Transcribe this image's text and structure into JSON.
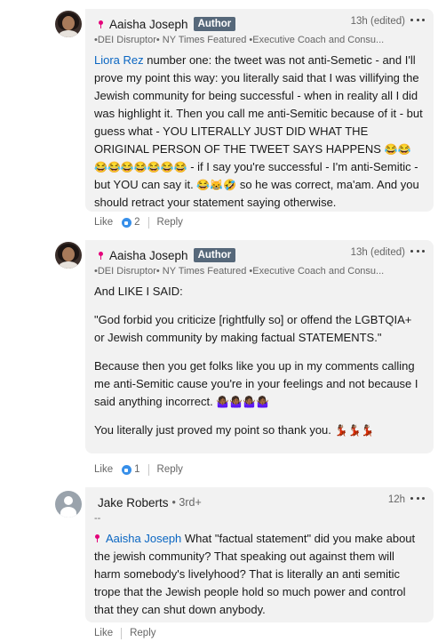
{
  "comments": [
    {
      "author": "Aaisha Joseph",
      "badge": "Author",
      "time": "13h (edited)",
      "headline": "•DEI Disruptor• NY Times Featured •Executive Coach and Consu...",
      "mention": "Liora Rez",
      "text_1": " number one: the tweet was not anti-Semetic - and I'll prove my point this way: you literally said that I was villifying the Jewish community for being successful - when in reality all I did was highlight it. Then you call me anti-Semitic because of it - but guess what - YOU LITERALLY JUST DID WHAT THE ORIGINAL PERSON OF THE TWEET SAYS HAPPENS ",
      "emoji_1": "😂😂😂😂😂😂😂😂😂",
      "text_2": " - if I say you're successful - I'm anti-Semitic - but YOU can say it. ",
      "emoji_2": "😂😹🤣",
      "text_3": " so he was correct, ma'am. And you should retract your statement saying otherwise.",
      "like_label": "Like",
      "like_count": "2",
      "reply_label": "Reply"
    },
    {
      "author": "Aaisha Joseph",
      "badge": "Author",
      "time": "13h (edited)",
      "headline": "•DEI Disruptor• NY Times Featured •Executive Coach and Consu...",
      "para_1": "And LIKE I SAID:",
      "para_2": "\"God forbid you criticize [rightfully so] or offend the LGBTQIA+ or Jewish community by making factual STATEMENTS.\"",
      "para_3": "Because then you get folks like you up in my comments calling me anti-Semitic cause you're in your feelings and not because I said anything incorrect. ",
      "para_3_emoji": "🤷🏾‍♀️🤷🏾‍♀️🤷🏾‍♀️🤷🏾‍♀️",
      "para_4": "You literally just proved my point so thank you. ",
      "para_4_emoji": "💃🏾💃🏾💃🏾",
      "like_label": "Like",
      "like_count": "1",
      "reply_label": "Reply"
    },
    {
      "author": "Jake Roberts",
      "degree": "• 3rd+",
      "time": "12h",
      "headline": "--",
      "mention": "Aaisha Joseph",
      "text": " What \"factual statement\" did you make about the jewish community? That speaking out against them will harm somebody's livelyhood? That is literally an anti semitic trope that the Jewish people hold so much power and control that they can shut down anybody.",
      "like_label": "Like",
      "reply_label": "Reply"
    }
  ],
  "colors": {
    "bubble": "#f2f2f2",
    "mention": "#0a66c2",
    "badge": "#56687a",
    "like_icon": "#378fe9"
  }
}
